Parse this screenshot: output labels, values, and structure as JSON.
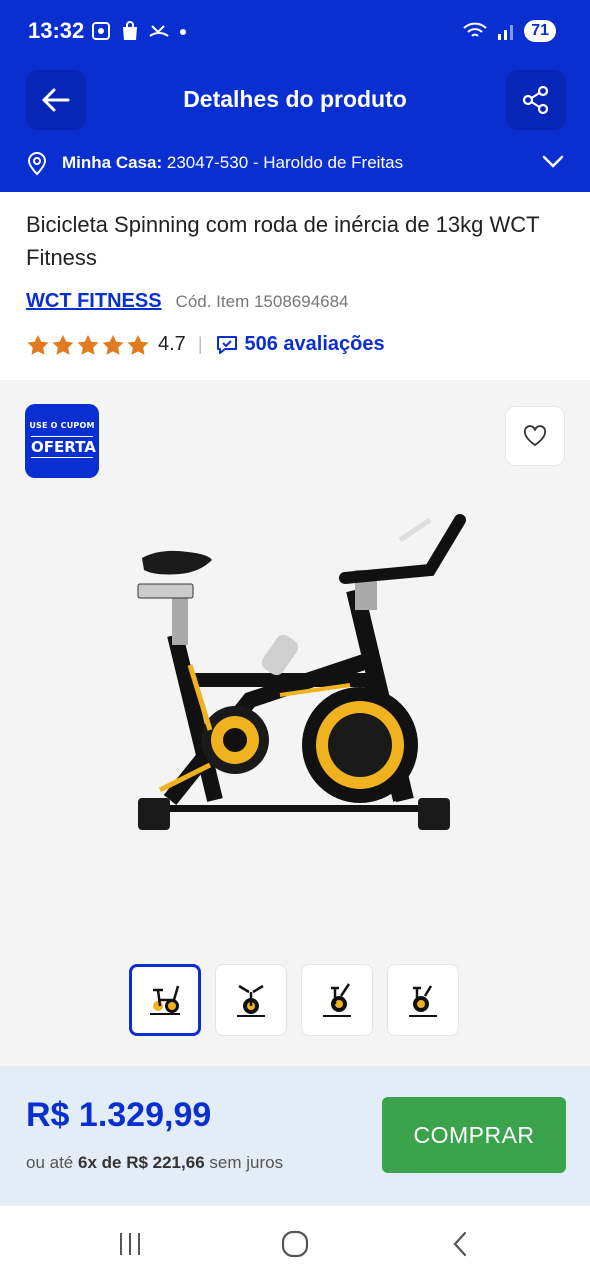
{
  "status_bar": {
    "time": "13:32",
    "battery": "71"
  },
  "header": {
    "title": "Detalhes do produto"
  },
  "address": {
    "label": "Minha Casa:",
    "value": "23047-530 - Haroldo de Freitas"
  },
  "product": {
    "title": "Bicicleta Spinning com roda de inércia de 13kg WCT Fitness",
    "brand": "WCT FITNESS",
    "item_code": "Cód. Item 1508694684",
    "rating": "4.7",
    "stars": 5,
    "reviews": "506 avaliações"
  },
  "gallery": {
    "coupon_line1": "USE O CUPOM",
    "coupon_line2": "OFERTA",
    "thumbnail_count": 4,
    "selected_thumbnail": 1
  },
  "purchase": {
    "price": "R$ 1.329,99",
    "installments_prefix": "ou até",
    "installments_count": "6x de R$ 221,66",
    "installments_suffix": "sem juros",
    "buy_label": "COMPRAR"
  },
  "colors": {
    "brand_blue": "#0a2fd1",
    "buy_green": "#3aa34b",
    "star_orange": "#e07b1f",
    "price_bar_bg": "#e3edf8"
  }
}
